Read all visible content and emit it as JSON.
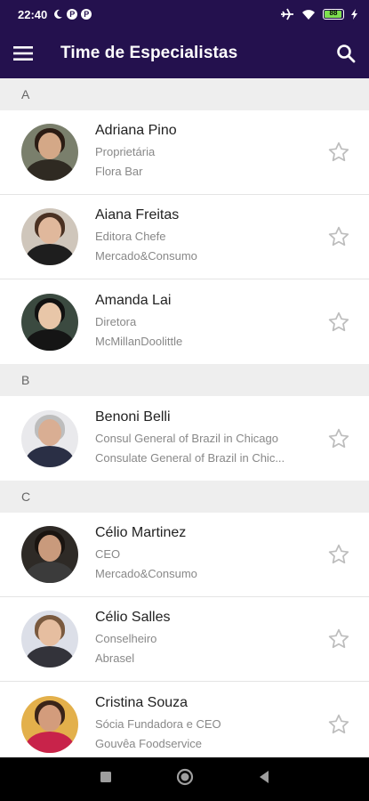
{
  "status": {
    "time": "22:40",
    "battery": "88"
  },
  "appbar": {
    "title": "Time de Especialistas"
  },
  "sections": [
    {
      "letter": "A",
      "people": [
        {
          "name": "Adriana Pino",
          "role": "Proprietária",
          "company": "Flora Bar"
        },
        {
          "name": "Aiana Freitas",
          "role": "Editora Chefe",
          "company": "Mercado&Consumo"
        },
        {
          "name": "Amanda Lai",
          "role": "Diretora",
          "company": "McMillanDoolittle"
        }
      ]
    },
    {
      "letter": "B",
      "people": [
        {
          "name": "Benoni Belli",
          "role": "Consul General of Brazil in Chicago",
          "company": "Consulate General of Brazil in Chic..."
        }
      ]
    },
    {
      "letter": "C",
      "people": [
        {
          "name": "Célio Martinez",
          "role": "CEO",
          "company": "Mercado&Consumo"
        },
        {
          "name": "Célio Salles",
          "role": "Conselheiro",
          "company": "Abrasel"
        },
        {
          "name": "Cristina Souza",
          "role": "Sócia Fundadora e CEO",
          "company": "Gouvêa Foodservice"
        }
      ]
    }
  ],
  "colors": {
    "primary": "#24114e",
    "section_bg": "#eeeeee",
    "star": "#bdbdbd"
  }
}
